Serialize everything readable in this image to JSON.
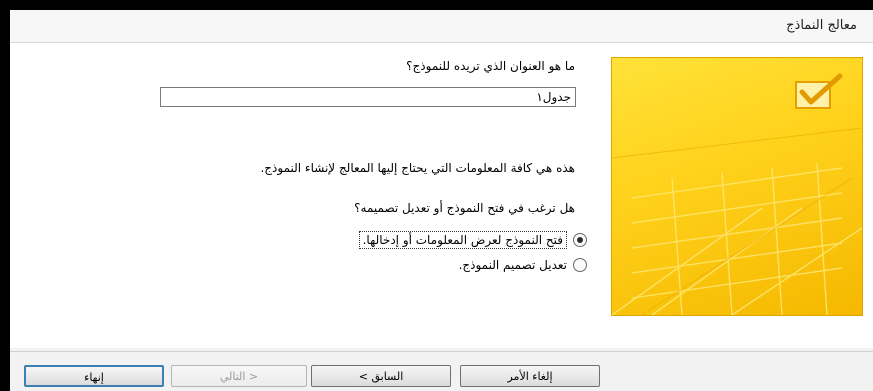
{
  "window": {
    "title": "معالج النماذج"
  },
  "form": {
    "title_question": "ما هو العنوان الذي تريده للنموذج؟",
    "title_value": "جدول١",
    "info_text": "هذه هي كافة المعلومات التي يحتاج إليها المعالج لإنشاء النموذج.",
    "question": "هل ترغب في فتح النموذج أو تعديل تصميمه؟",
    "options": [
      {
        "label": "فتح النموذج لعرض المعلومات أو إدخالها.",
        "selected": true
      },
      {
        "label": "تعديل تصميم النموذج.",
        "selected": false
      }
    ]
  },
  "buttons": {
    "cancel": "إلغاء الأمر",
    "back": "< السابق",
    "next": "التالي >",
    "finish": "إنهاء"
  },
  "icons": {
    "wizard_art": "checkmark-icon",
    "panel_color": "#ffd21c"
  }
}
